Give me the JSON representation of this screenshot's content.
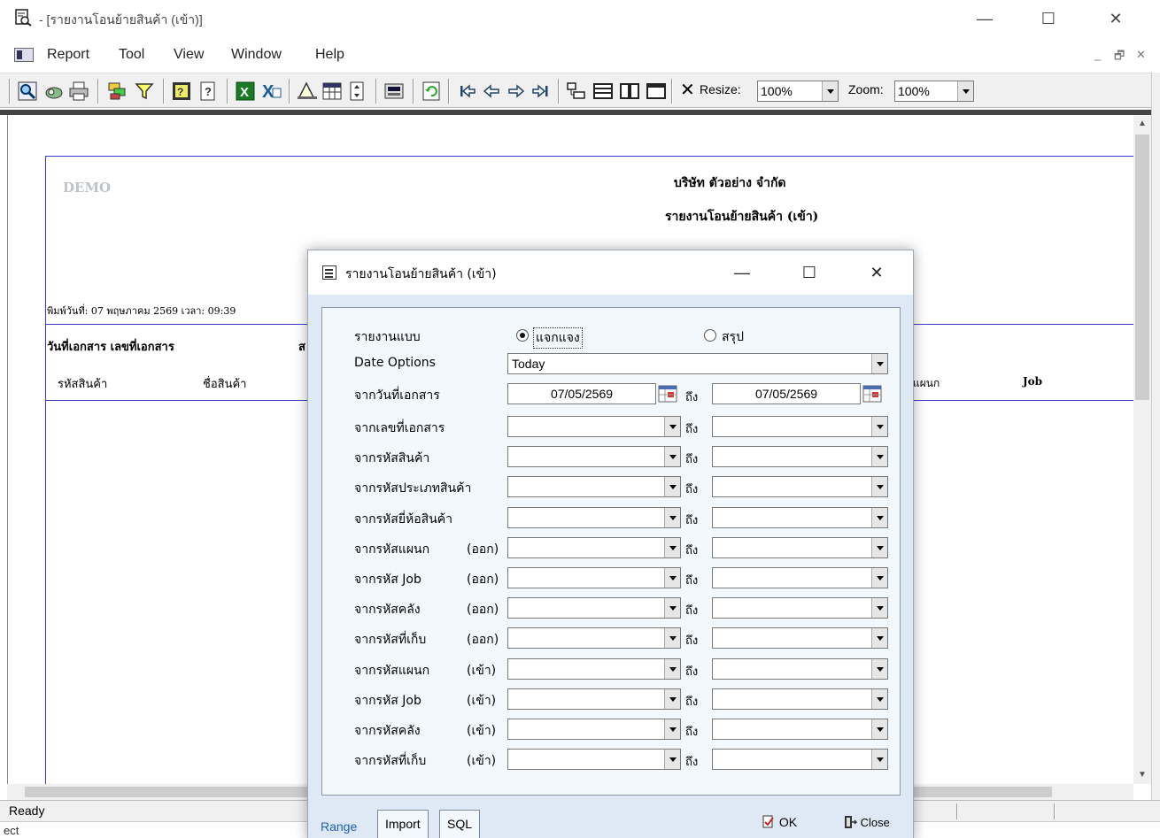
{
  "window": {
    "title": "- [รายงานโอนย้ายสินค้า (เข้า)]",
    "controls": {
      "minimize": "—",
      "maximize": "☐",
      "close": "✕"
    }
  },
  "menu": {
    "items": [
      "Report",
      "Tool",
      "View",
      "Window",
      "Help"
    ],
    "mdi_controls": {
      "minimize": "_",
      "restore": "🗗",
      "close": "✕"
    }
  },
  "toolbar": {
    "close_glyph": "✕",
    "resize_label": "Resize:",
    "resize_value": "100%",
    "zoom_label": "Zoom:",
    "zoom_value": "100%"
  },
  "report": {
    "watermark": "DEMO",
    "company": "บริษัท ตัวอย่าง จำกัด",
    "title": "รายงานโอนย้ายสินค้า (เข้า)",
    "print_info": "พิมพ์วันที่: 07 พฤษภาคม 2569  เวลา: 09:39",
    "header1": "วันที่เอกสาร  เลขที่เอกสาร",
    "header1_partial": "ส",
    "col_product_code": "รหัสสินค้า",
    "col_product_name": "ชื่อสินค้า",
    "col_department": "แผนก",
    "col_job": "Job"
  },
  "status": {
    "text": "Ready",
    "bottom_text": "ect"
  },
  "dialog": {
    "title": "รายงานโอนย้ายสินค้า (เข้า)",
    "controls": {
      "minimize": "—",
      "maximize": "☐",
      "close": "✕"
    },
    "report_type_label": "รายงานแบบ",
    "report_type_options": [
      "แจกแจง",
      "สรุป"
    ],
    "report_type_selected": "แจกแจง",
    "date_options_label": "Date Options",
    "date_options_value": "Today",
    "to_label": "ถึง",
    "doc_date_label": "จากวันที่เอกสาร",
    "date_from": "07/05/2569",
    "date_to": "07/05/2569",
    "range_fields": [
      {
        "label": "จากเลขที่เอกสาร",
        "sub": ""
      },
      {
        "label": "จากรหัสสินค้า",
        "sub": ""
      },
      {
        "label": "จากรหัสประเภทสินค้า",
        "sub": ""
      },
      {
        "label": "จากรหัสยี่ห้อสินค้า",
        "sub": ""
      },
      {
        "label": "จากรหัสแผนก",
        "sub": "(ออก)"
      },
      {
        "label": "จากรหัส Job",
        "sub": "(ออก)"
      },
      {
        "label": "จากรหัสคลัง",
        "sub": "(ออก)"
      },
      {
        "label": "จากรหัสที่เก็บ",
        "sub": "(ออก)"
      },
      {
        "label": "จากรหัสแผนก",
        "sub": "(เข้า)"
      },
      {
        "label": "จากรหัส Job",
        "sub": "(เข้า)"
      },
      {
        "label": "จากรหัสคลัง",
        "sub": "(เข้า)"
      },
      {
        "label": "จากรหัสที่เก็บ",
        "sub": "(เข้า)"
      }
    ],
    "tabs": [
      "Range",
      "Import",
      "SQL"
    ],
    "ok_label": "OK",
    "close_label": "Close"
  },
  "colors": {
    "accent_blue": "#3a3ad0",
    "dialog_bg": "#dfe9f5",
    "panel_bg": "#f2f8fc",
    "active_tab": "#1f5fbf"
  }
}
